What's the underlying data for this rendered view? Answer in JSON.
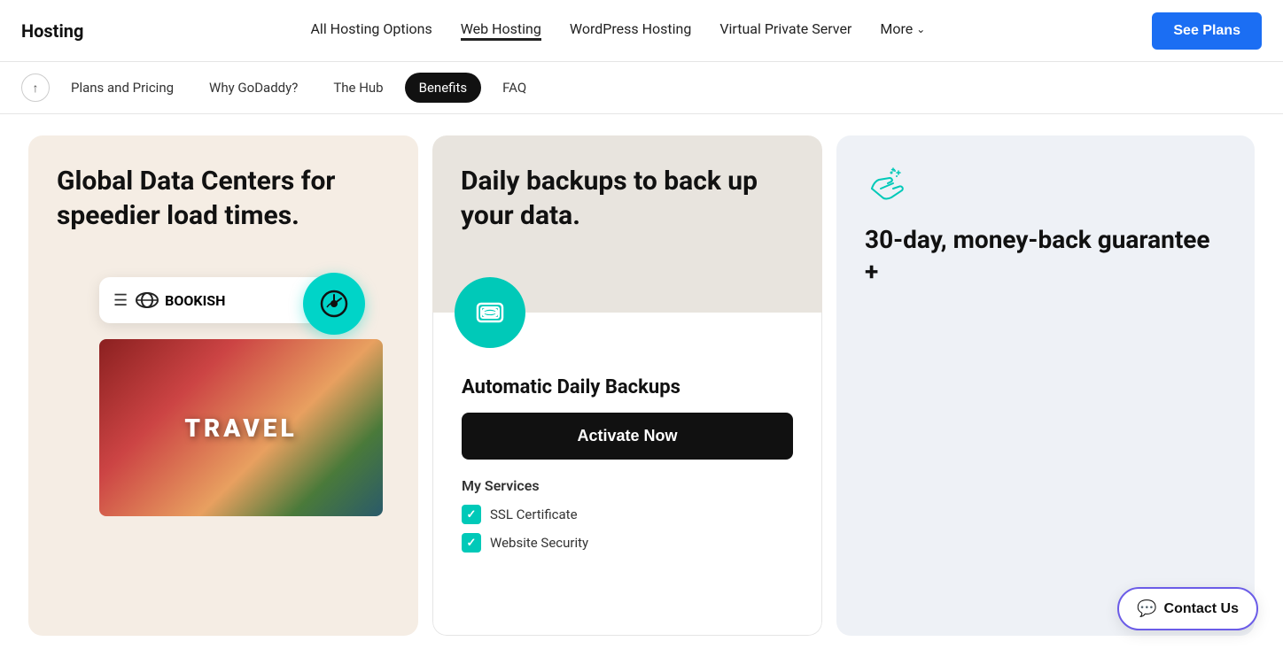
{
  "nav": {
    "logo": "Hosting",
    "links": [
      {
        "id": "all-hosting",
        "label": "All Hosting Options",
        "active": false
      },
      {
        "id": "web-hosting",
        "label": "Web Hosting",
        "active": true
      },
      {
        "id": "wordpress",
        "label": "WordPress Hosting",
        "active": false
      },
      {
        "id": "vps",
        "label": "Virtual Private Server",
        "active": false
      },
      {
        "id": "more",
        "label": "More",
        "active": false
      }
    ],
    "see_plans_label": "See Plans"
  },
  "sub_nav": {
    "items": [
      {
        "id": "plans",
        "label": "Plans and Pricing",
        "active": false
      },
      {
        "id": "why",
        "label": "Why GoDaddy?",
        "active": false
      },
      {
        "id": "hub",
        "label": "The Hub",
        "active": false
      },
      {
        "id": "benefits",
        "label": "Benefits",
        "active": true
      },
      {
        "id": "faq",
        "label": "FAQ",
        "active": false
      }
    ]
  },
  "cards": {
    "card1": {
      "title": "Global Data Centers for speedier load times.",
      "bookish_label": "BOOKISH",
      "travel_label": "TRAVEL"
    },
    "card2": {
      "top_title": "Daily backups to back up your data.",
      "subtitle": "Automatic Daily Backups",
      "activate_label": "Activate Now",
      "my_services_title": "My Services",
      "services": [
        {
          "label": "SSL Certificate"
        },
        {
          "label": "Website Security"
        }
      ]
    },
    "card3": {
      "title": "30-day, money-back guarantee +"
    }
  },
  "contact_us": {
    "label": "Contact Us"
  },
  "colors": {
    "teal": "#00c9b8",
    "blue": "#1b6ef3",
    "purple": "#6b5ce7"
  }
}
